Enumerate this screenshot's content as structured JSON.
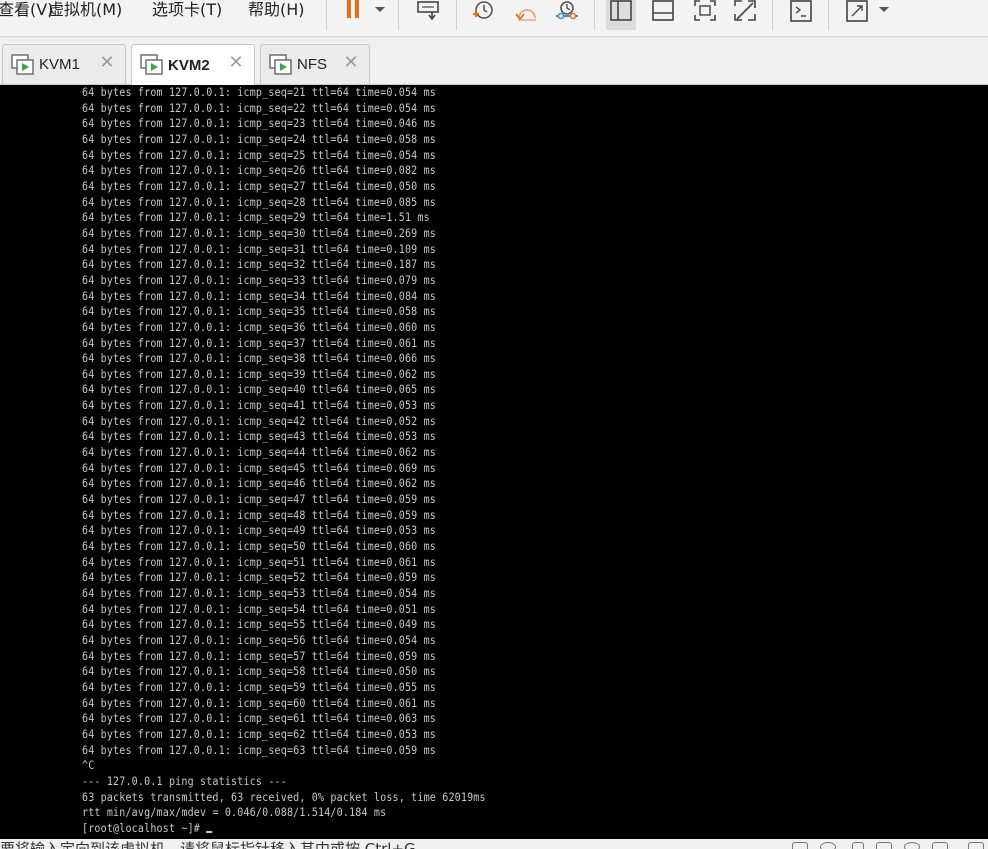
{
  "menu": {
    "view": "查看(V)",
    "vm": "虚拟机(M)",
    "tabs": "选项卡(T)",
    "help": "帮助(H)"
  },
  "toolbar": {
    "icons": [
      "pause-icon",
      "send-keys-icon",
      "snapshot-take-icon",
      "snapshot-revert-icon",
      "snapshot-manager-icon",
      "view-sidebar-icon",
      "view-thumbnail-icon",
      "fullscreen-icon",
      "unity-icon",
      "console-icon",
      "stretch-icon"
    ],
    "accent_color": "#e8701a"
  },
  "tabs": [
    {
      "label": "KVM1",
      "active": false
    },
    {
      "label": "KVM2",
      "active": true
    },
    {
      "label": "NFS",
      "active": false
    }
  ],
  "console": {
    "lines": [
      "64 bytes from 127.0.0.1: icmp_seq=21 ttl=64 time=0.054 ms",
      "64 bytes from 127.0.0.1: icmp_seq=22 ttl=64 time=0.054 ms",
      "64 bytes from 127.0.0.1: icmp_seq=23 ttl=64 time=0.046 ms",
      "64 bytes from 127.0.0.1: icmp_seq=24 ttl=64 time=0.058 ms",
      "64 bytes from 127.0.0.1: icmp_seq=25 ttl=64 time=0.054 ms",
      "64 bytes from 127.0.0.1: icmp_seq=26 ttl=64 time=0.082 ms",
      "64 bytes from 127.0.0.1: icmp_seq=27 ttl=64 time=0.050 ms",
      "64 bytes from 127.0.0.1: icmp_seq=28 ttl=64 time=0.085 ms",
      "64 bytes from 127.0.0.1: icmp_seq=29 ttl=64 time=1.51 ms",
      "64 bytes from 127.0.0.1: icmp_seq=30 ttl=64 time=0.269 ms",
      "64 bytes from 127.0.0.1: icmp_seq=31 ttl=64 time=0.109 ms",
      "64 bytes from 127.0.0.1: icmp_seq=32 ttl=64 time=0.187 ms",
      "64 bytes from 127.0.0.1: icmp_seq=33 ttl=64 time=0.079 ms",
      "64 bytes from 127.0.0.1: icmp_seq=34 ttl=64 time=0.084 ms",
      "64 bytes from 127.0.0.1: icmp_seq=35 ttl=64 time=0.058 ms",
      "64 bytes from 127.0.0.1: icmp_seq=36 ttl=64 time=0.060 ms",
      "64 bytes from 127.0.0.1: icmp_seq=37 ttl=64 time=0.061 ms",
      "64 bytes from 127.0.0.1: icmp_seq=38 ttl=64 time=0.066 ms",
      "64 bytes from 127.0.0.1: icmp_seq=39 ttl=64 time=0.062 ms",
      "64 bytes from 127.0.0.1: icmp_seq=40 ttl=64 time=0.065 ms",
      "64 bytes from 127.0.0.1: icmp_seq=41 ttl=64 time=0.053 ms",
      "64 bytes from 127.0.0.1: icmp_seq=42 ttl=64 time=0.052 ms",
      "64 bytes from 127.0.0.1: icmp_seq=43 ttl=64 time=0.053 ms",
      "64 bytes from 127.0.0.1: icmp_seq=44 ttl=64 time=0.062 ms",
      "64 bytes from 127.0.0.1: icmp_seq=45 ttl=64 time=0.069 ms",
      "64 bytes from 127.0.0.1: icmp_seq=46 ttl=64 time=0.062 ms",
      "64 bytes from 127.0.0.1: icmp_seq=47 ttl=64 time=0.059 ms",
      "64 bytes from 127.0.0.1: icmp_seq=48 ttl=64 time=0.059 ms",
      "64 bytes from 127.0.0.1: icmp_seq=49 ttl=64 time=0.053 ms",
      "64 bytes from 127.0.0.1: icmp_seq=50 ttl=64 time=0.060 ms",
      "64 bytes from 127.0.0.1: icmp_seq=51 ttl=64 time=0.061 ms",
      "64 bytes from 127.0.0.1: icmp_seq=52 ttl=64 time=0.059 ms",
      "64 bytes from 127.0.0.1: icmp_seq=53 ttl=64 time=0.054 ms",
      "64 bytes from 127.0.0.1: icmp_seq=54 ttl=64 time=0.051 ms",
      "64 bytes from 127.0.0.1: icmp_seq=55 ttl=64 time=0.049 ms",
      "64 bytes from 127.0.0.1: icmp_seq=56 ttl=64 time=0.054 ms",
      "64 bytes from 127.0.0.1: icmp_seq=57 ttl=64 time=0.059 ms",
      "64 bytes from 127.0.0.1: icmp_seq=58 ttl=64 time=0.050 ms",
      "64 bytes from 127.0.0.1: icmp_seq=59 ttl=64 time=0.055 ms",
      "64 bytes from 127.0.0.1: icmp_seq=60 ttl=64 time=0.061 ms",
      "64 bytes from 127.0.0.1: icmp_seq=61 ttl=64 time=0.063 ms",
      "64 bytes from 127.0.0.1: icmp_seq=62 ttl=64 time=0.053 ms",
      "64 bytes from 127.0.0.1: icmp_seq=63 ttl=64 time=0.059 ms",
      "^C",
      "--- 127.0.0.1 ping statistics ---",
      "63 packets transmitted, 63 received, 0% packet loss, time 62019ms",
      "rtt min/avg/max/mdev = 0.046/0.088/1.514/0.184 ms"
    ],
    "prompt": "[root@localhost ~]# "
  },
  "statusbar": {
    "text": "要将输入定向到该虚拟机，请将鼠标指针移入其中或按 Ctrl+G。"
  }
}
